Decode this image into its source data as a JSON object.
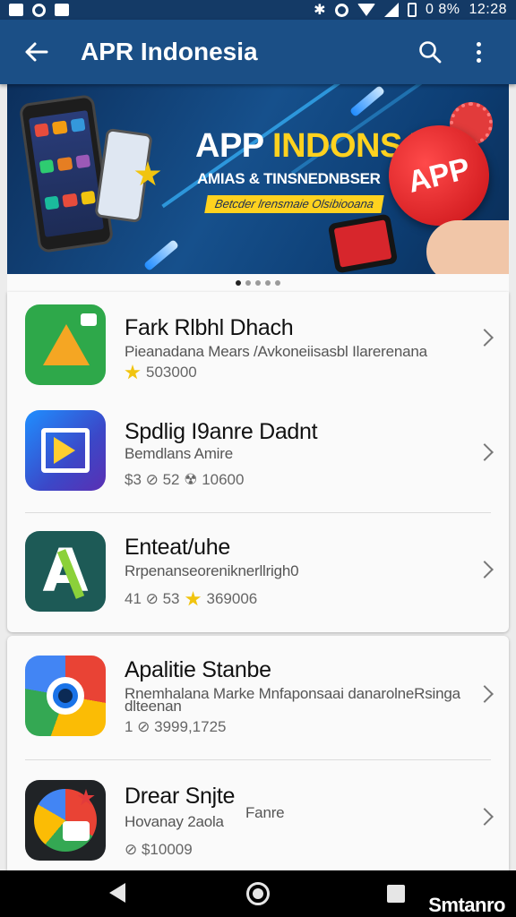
{
  "status_bar": {
    "battery": "0 8%",
    "time": "12:28"
  },
  "app_bar": {
    "title": "APR Indonesia"
  },
  "banner": {
    "headline_white": "APP ",
    "headline_yellow": "INDONSA",
    "subtitle": "AMIAS & TINSNEDNBSER",
    "tagline": "Betcder lrensmaie Olsibiooana",
    "badge": "APP",
    "pager_count": 5,
    "pager_active": 0
  },
  "apps": [
    {
      "name": "Fark Rlbhl Dhach",
      "description": "Pieanadana Mears /Avkoneiisasbl Ilarerenana",
      "meta": "503000",
      "meta_icon": "star-icon"
    },
    {
      "name": "Spdlig I9anre Dadnt",
      "description": "Bemdlans Amire",
      "meta": "$3 ⊘ 52 ☢ 10600"
    },
    {
      "name": "Enteat/uhe",
      "description": "Rrpenanseoreniknerllrigh0",
      "meta": "41 ⊘ 53",
      "meta_value": "369006",
      "meta_icon": "star-icon"
    },
    {
      "name": "Apalitie Stanbe",
      "description": "Rnemhalana Marke Mnfaponsaai danarolneRsinga",
      "description2": "dlteenan",
      "meta": "1 ⊘ 3999,1725"
    },
    {
      "name": "Drear Snjte",
      "description": "Hovanay 2aola",
      "description_extra": "Fanre",
      "meta": "⊘ $10009"
    }
  ],
  "nav_bar": {
    "watermark": "Smtanro"
  },
  "colors": {
    "app_bar": "#1b4f86",
    "status_bar": "#143a66",
    "accent_yellow": "#ffd21f",
    "badge_red": "#d7262c"
  }
}
